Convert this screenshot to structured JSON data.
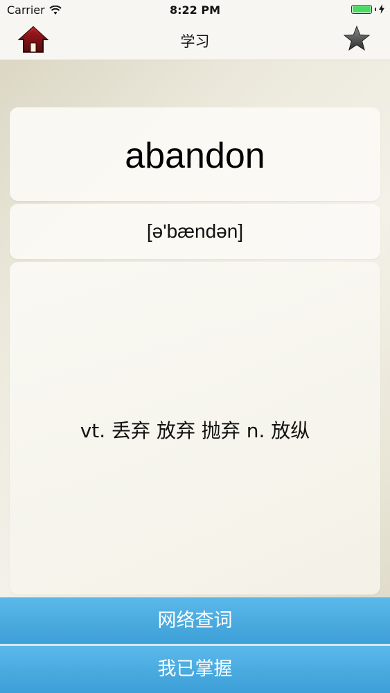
{
  "status_bar": {
    "carrier": "Carrier",
    "time": "8:22 PM",
    "battery_level": 1.0
  },
  "nav": {
    "title": "学习",
    "home_icon": "home-icon",
    "favorite_icon": "star-icon"
  },
  "word": {
    "text": "abandon",
    "phonetic": "[ə'bændən]",
    "meaning": "vt. 丢弃 放弃 抛弃 n. 放纵"
  },
  "actions": {
    "lookup_label": "网络查词",
    "mastered_label": "我已掌握"
  },
  "colors": {
    "button_blue": "#4aaee3",
    "battery_green": "#4cd964",
    "home_red": "#a0141a"
  }
}
